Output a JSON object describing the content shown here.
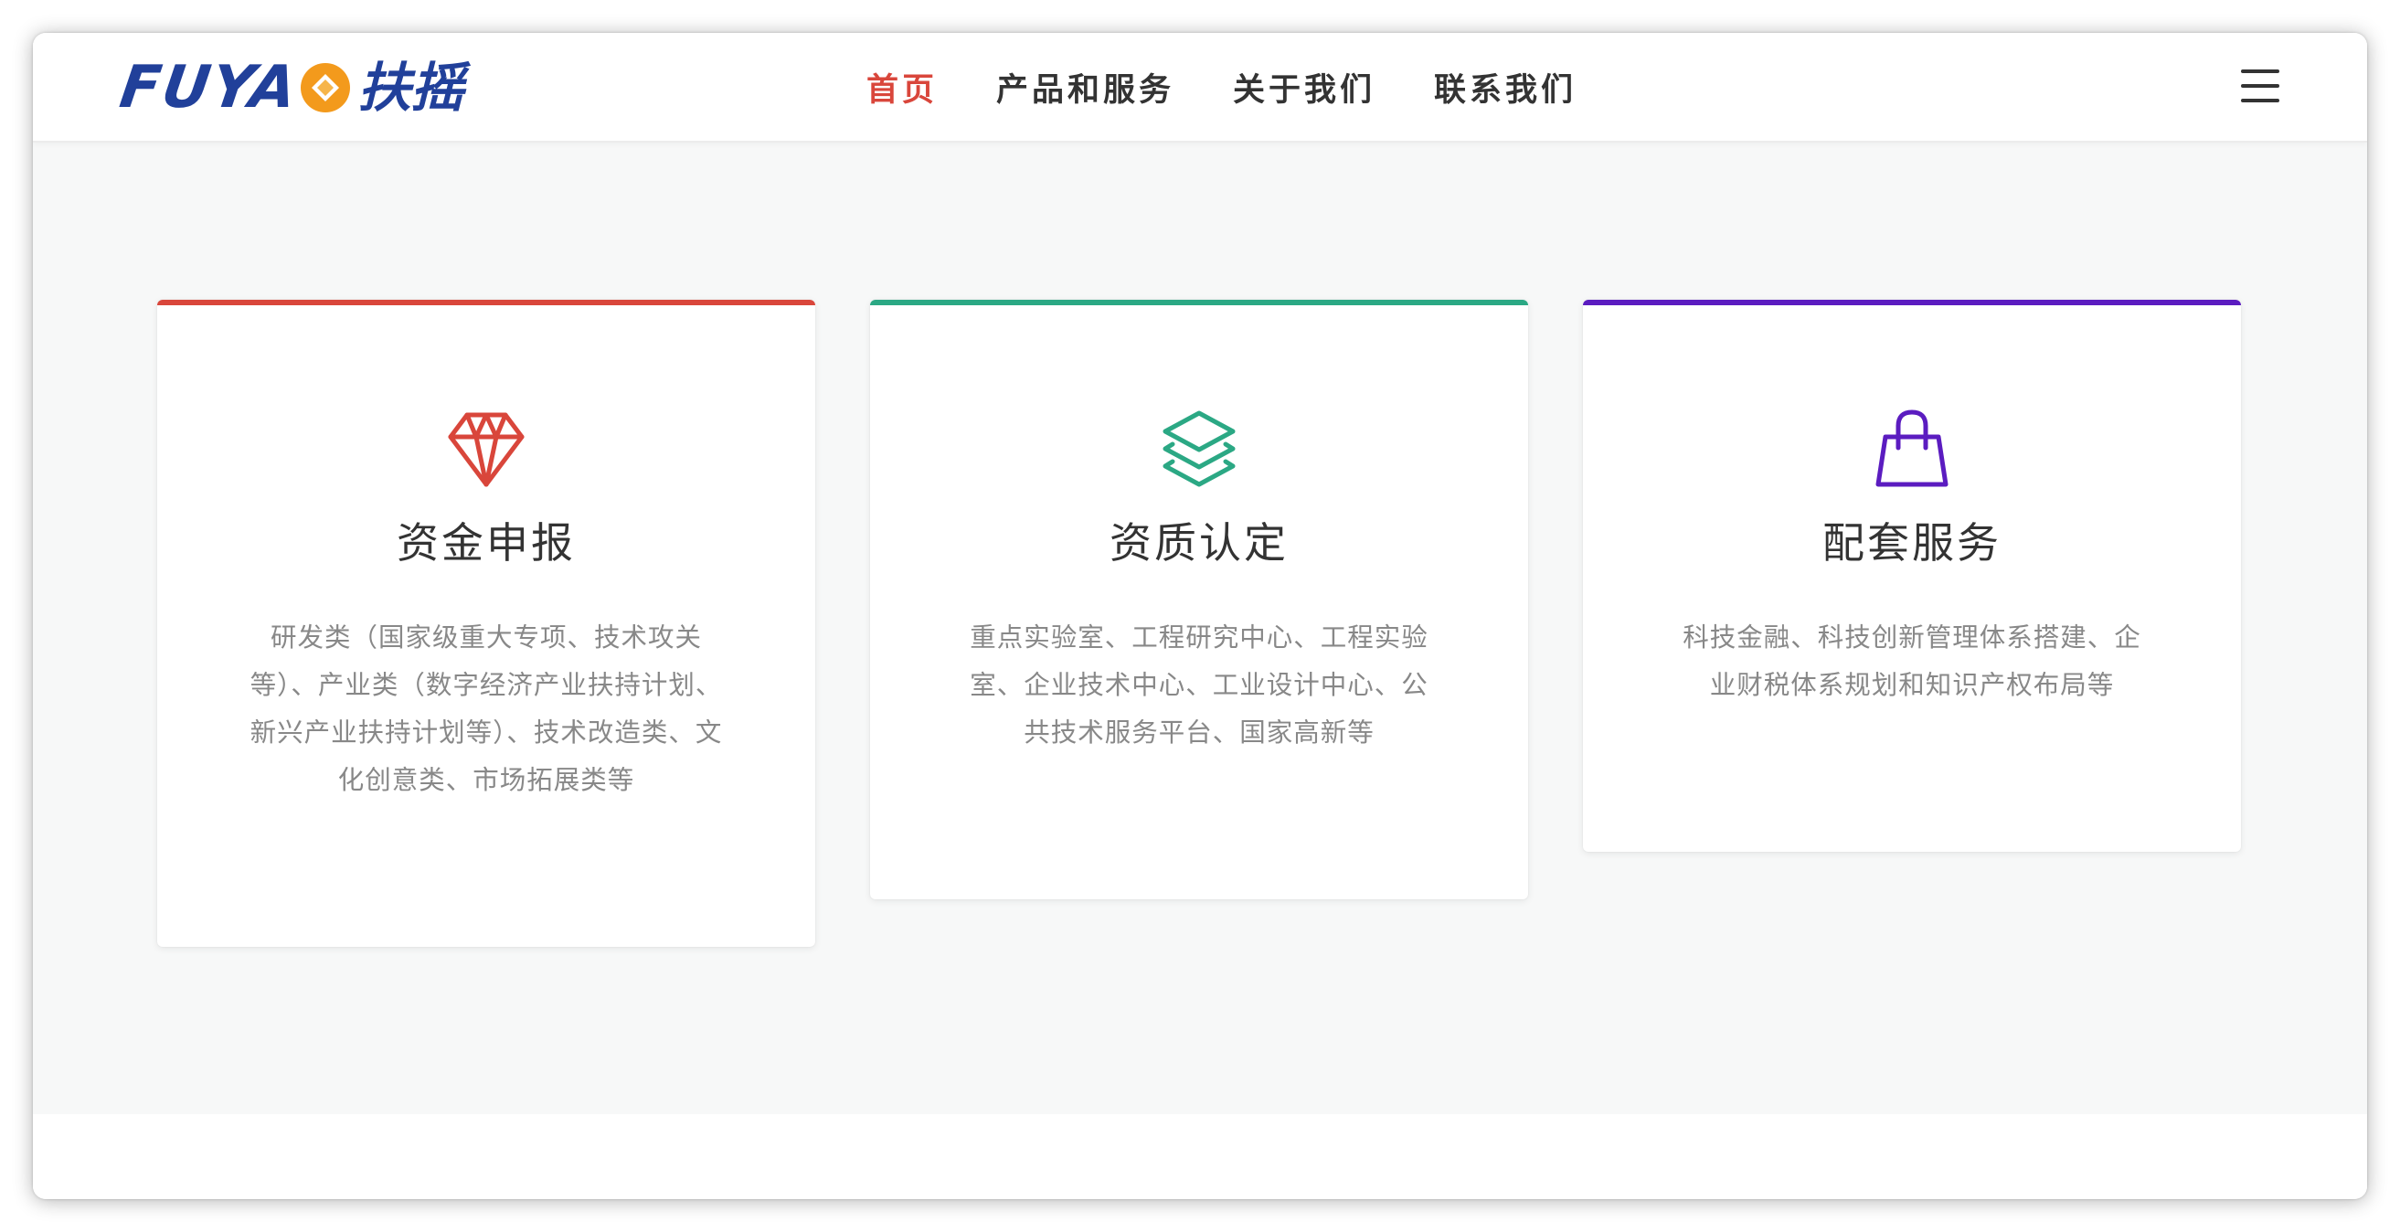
{
  "header": {
    "logo": {
      "latin": "FUYA",
      "chinese": "扶摇",
      "brand_color": "#21409a",
      "mark_color": "#f39a1c"
    },
    "nav": [
      {
        "label": "首页",
        "active": true
      },
      {
        "label": "产品和服务",
        "active": false
      },
      {
        "label": "关于我们",
        "active": false
      },
      {
        "label": "联系我们",
        "active": false
      }
    ],
    "active_color": "#d9463b",
    "menu_icon": "hamburger-menu-icon"
  },
  "cards": [
    {
      "title": "资金申报",
      "description": "研发类（国家级重大专项、技术攻关等）、产业类（数字经济产业扶持计划、新兴产业扶持计划等）、技术改造类、文化创意类、市场拓展类等",
      "icon": "diamond-icon",
      "accent": "#d9463b"
    },
    {
      "title": "资质认定",
      "description": "重点实验室、工程研究中心、工程实验室、企业技术中心、工业设计中心、公共技术服务平台、国家高新等",
      "icon": "layers-icon",
      "accent": "#2ba884"
    },
    {
      "title": "配套服务",
      "description": "科技金融、科技创新管理体系搭建、企业财税体系规划和知识产权布局等",
      "icon": "shopping-bag-icon",
      "accent": "#5b1cc0"
    }
  ]
}
